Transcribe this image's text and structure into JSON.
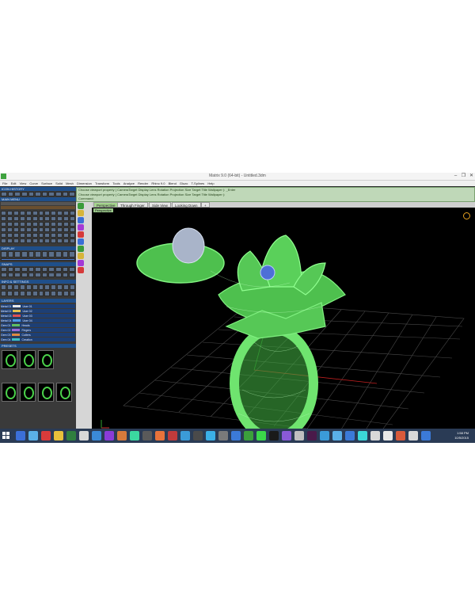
{
  "window": {
    "title": "Matrix 9.0 (64-bit) - Untitled.3dm",
    "minimize_glyph": "–",
    "restore_glyph": "❐",
    "close_glyph": "✕"
  },
  "menubar": [
    "File",
    "Edit",
    "View",
    "Curve",
    "Surface",
    "Solid",
    "Mesh",
    "Dimension",
    "Transform",
    "Tools",
    "Analyze",
    "Render",
    "Rhino 9.0",
    "Blend",
    "Gluzo",
    "T-Splines",
    "Help"
  ],
  "command_lines": [
    "Choose viewport property ( CameraTarget Display Lens Rotation Projection Size Target Title Wallpaper ): _Enter",
    "Choose viewport property ( CameraTarget Display Lens Rotation Projection Size Target Title Wallpaper ):",
    "Command:"
  ],
  "panels": {
    "icon_history": "ICON HISTORY",
    "main_menu": "MAIN MENU",
    "display": "DISPLAY",
    "snaps": "SNAPS",
    "info_settings": "INFO & SETTINGS",
    "layers": "LAYERS",
    "presets": "PRESETS"
  },
  "layers": [
    {
      "name": "Metal 01",
      "user": "User 01",
      "color": "#e8e8e8"
    },
    {
      "name": "Metal 02",
      "user": "User 02",
      "color": "#e6c24d"
    },
    {
      "name": "Metal 03",
      "user": "User 03",
      "color": "#e05050"
    },
    {
      "name": "Metal 04",
      "user": "User 04",
      "color": "#4d9be6"
    },
    {
      "name": "Gem 01",
      "user": "Heads",
      "color": "#60c060"
    },
    {
      "name": "Gem 02",
      "user": "Fingers",
      "color": "#9a6ad8"
    },
    {
      "name": "Gem 03",
      "user": "Cutters",
      "color": "#e08a40"
    },
    {
      "name": "Gem 04",
      "user": "Creation",
      "color": "#40c0c0"
    }
  ],
  "viewport_tabs": [
    "Perspective",
    "Through Finger",
    "Side View",
    "Looking Down",
    "+"
  ],
  "viewport_label": "Perspective",
  "taskbar": {
    "time": "1:58 PM",
    "date": "10/5/2015"
  },
  "colors": {
    "model_green": "#6fe46f",
    "model_fill": "#3fa83f",
    "pearl": "#a9b4c9",
    "gem_blue": "#4d6fd6",
    "taskbar": "#2a3b55",
    "grid": "#555555"
  }
}
